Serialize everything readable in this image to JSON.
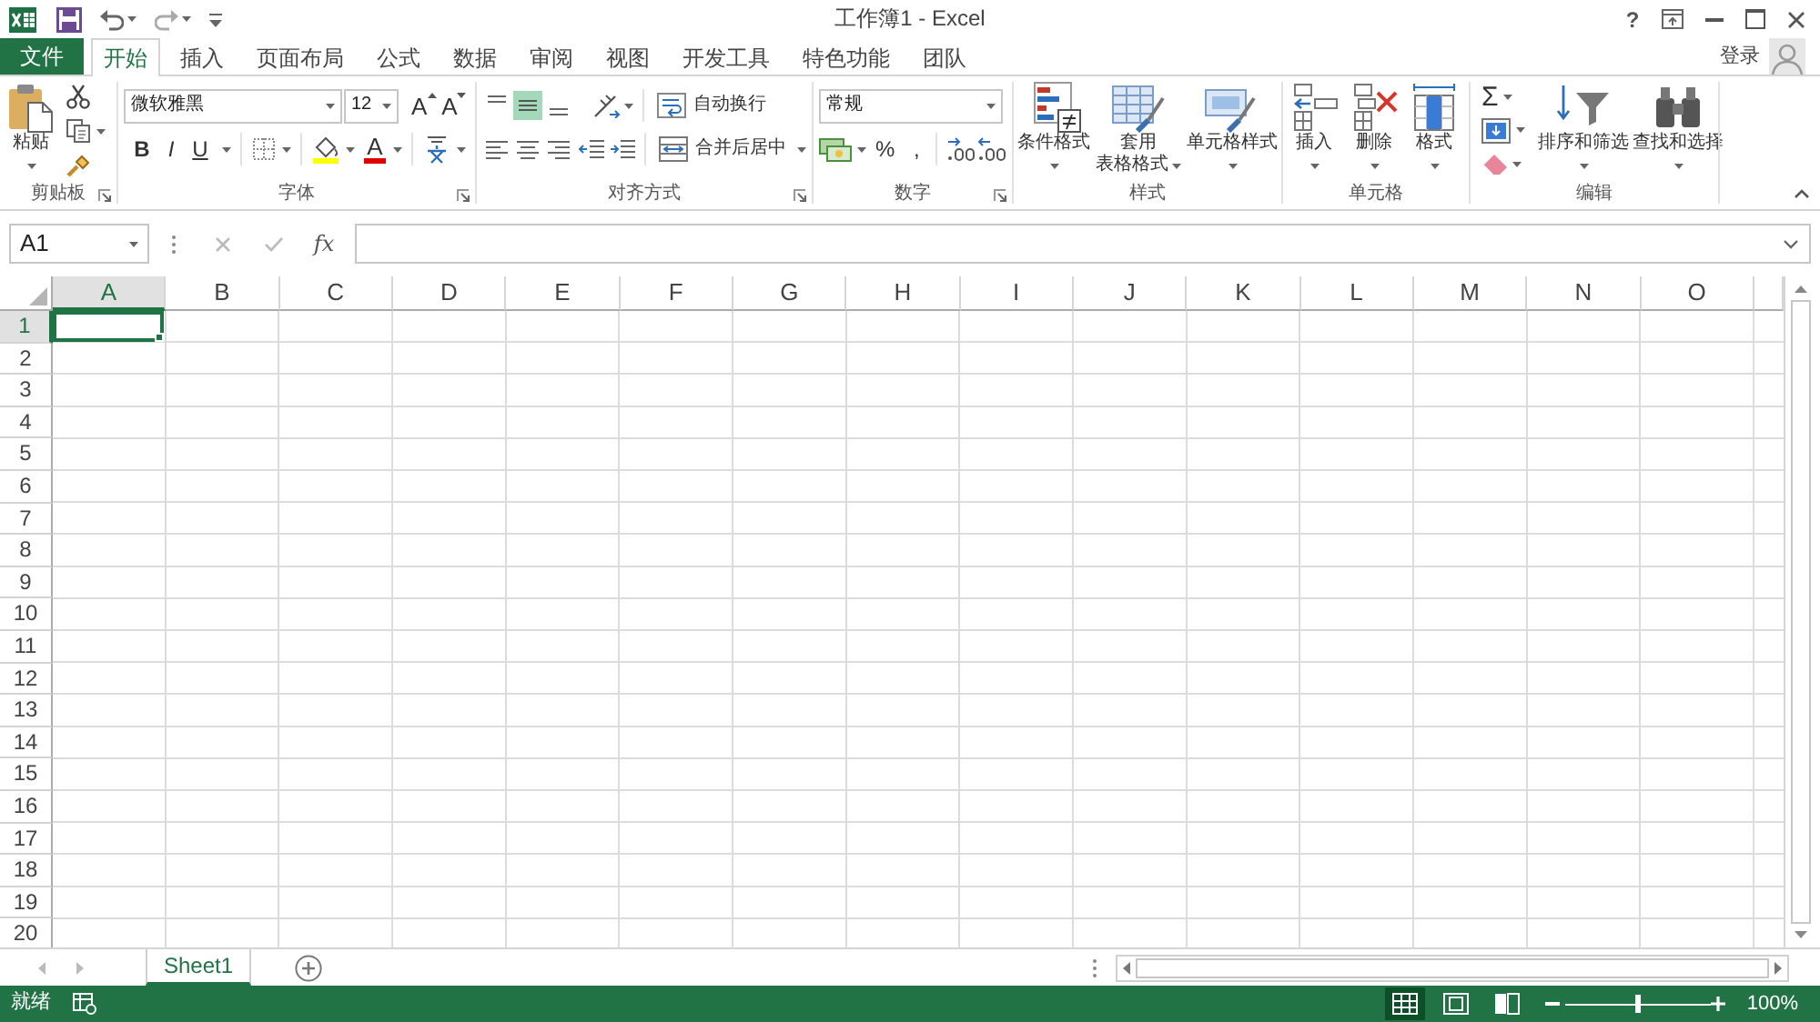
{
  "window": {
    "title": "工作簿1 - Excel",
    "help": "?",
    "account": "登录"
  },
  "tabs": [
    {
      "label": "文件",
      "kind": "file",
      "selected": false
    },
    {
      "label": "开始",
      "kind": "tab",
      "selected": true
    },
    {
      "label": "插入",
      "kind": "tab",
      "selected": false
    },
    {
      "label": "页面布局",
      "kind": "tab",
      "selected": false
    },
    {
      "label": "公式",
      "kind": "tab",
      "selected": false
    },
    {
      "label": "数据",
      "kind": "tab",
      "selected": false
    },
    {
      "label": "审阅",
      "kind": "tab",
      "selected": false
    },
    {
      "label": "视图",
      "kind": "tab",
      "selected": false
    },
    {
      "label": "开发工具",
      "kind": "tab",
      "selected": false
    },
    {
      "label": "特色功能",
      "kind": "tab",
      "selected": false
    },
    {
      "label": "团队",
      "kind": "tab",
      "selected": false
    }
  ],
  "ribbon": {
    "groups": [
      {
        "kind": "clipboard",
        "label": "剪贴板",
        "launcher": true,
        "paste": "粘贴"
      },
      {
        "kind": "font",
        "label": "字体",
        "launcher": true,
        "font_name": "微软雅黑",
        "font_size": "12",
        "grow_font": "A",
        "shrink_font": "A",
        "styles": [
          "B",
          "I",
          "U"
        ],
        "font_color": "A"
      },
      {
        "kind": "alignment",
        "label": "对齐方式",
        "launcher": true,
        "vertical_align": [
          {
            "selected": false
          },
          {
            "selected": true
          },
          {
            "selected": false
          }
        ],
        "horizontal_align": [
          {
            "selected": false
          },
          {
            "selected": false
          },
          {
            "selected": false
          }
        ],
        "wrap_text": "自动换行",
        "merge": "合并后居中"
      },
      {
        "kind": "number",
        "label": "数字",
        "launcher": true,
        "format": "常规",
        "percent": "%",
        "comma": ","
      },
      {
        "kind": "styles",
        "label": "样式",
        "launcher": false,
        "buttons": [
          {
            "kind": "conditional",
            "lines": [
              "条件格式"
            ]
          },
          {
            "kind": "table",
            "lines": [
              "套用",
              "表格格式"
            ]
          },
          {
            "kind": "cell_styles",
            "lines": [
              "单元格样式"
            ]
          }
        ]
      },
      {
        "kind": "cells",
        "label": "单元格",
        "launcher": false,
        "buttons": [
          {
            "kind": "insert",
            "lines": [
              "插入"
            ]
          },
          {
            "kind": "delete",
            "lines": [
              "删除"
            ]
          },
          {
            "kind": "format",
            "lines": [
              "格式"
            ]
          }
        ]
      },
      {
        "kind": "editing",
        "label": "编辑",
        "launcher": false,
        "autosum": "Σ",
        "buttons": [
          {
            "kind": "sort",
            "lines": [
              "排序和筛选"
            ]
          },
          {
            "kind": "find",
            "lines": [
              "查找和选择"
            ]
          }
        ]
      }
    ]
  },
  "formula_bar": {
    "name_box": "A1",
    "function": "fx"
  },
  "sheet": {
    "columns": [
      {
        "label": "A",
        "selected": true
      },
      {
        "label": "B",
        "selected": false
      },
      {
        "label": "C",
        "selected": false
      },
      {
        "label": "D",
        "selected": false
      },
      {
        "label": "E",
        "selected": false
      },
      {
        "label": "F",
        "selected": false
      },
      {
        "label": "G",
        "selected": false
      },
      {
        "label": "H",
        "selected": false
      },
      {
        "label": "I",
        "selected": false
      },
      {
        "label": "J",
        "selected": false
      },
      {
        "label": "K",
        "selected": false
      },
      {
        "label": "L",
        "selected": false
      },
      {
        "label": "M",
        "selected": false
      },
      {
        "label": "N",
        "selected": false
      },
      {
        "label": "O",
        "selected": false
      }
    ],
    "rows": [
      {
        "label": "1",
        "selected": true
      },
      {
        "label": "2",
        "selected": false
      },
      {
        "label": "3",
        "selected": false
      },
      {
        "label": "4",
        "selected": false
      },
      {
        "label": "5",
        "selected": false
      },
      {
        "label": "6",
        "selected": false
      },
      {
        "label": "7",
        "selected": false
      },
      {
        "label": "8",
        "selected": false
      },
      {
        "label": "9",
        "selected": false
      },
      {
        "label": "10",
        "selected": false
      },
      {
        "label": "11",
        "selected": false
      },
      {
        "label": "12",
        "selected": false
      },
      {
        "label": "13",
        "selected": false
      },
      {
        "label": "14",
        "selected": false
      },
      {
        "label": "15",
        "selected": false
      },
      {
        "label": "16",
        "selected": false
      },
      {
        "label": "17",
        "selected": false
      },
      {
        "label": "18",
        "selected": false
      },
      {
        "label": "19",
        "selected": false
      },
      {
        "label": "20",
        "selected": false
      }
    ]
  },
  "sheet_tabs": [
    {
      "label": "Sheet1",
      "selected": true
    }
  ],
  "status_bar": {
    "status": "就绪",
    "views": [
      {
        "kind": "normal",
        "selected": true
      },
      {
        "kind": "page_layout",
        "selected": false
      },
      {
        "kind": "page_break",
        "selected": false
      }
    ],
    "zoom": {
      "level": 0.5,
      "reading": "100%"
    }
  }
}
